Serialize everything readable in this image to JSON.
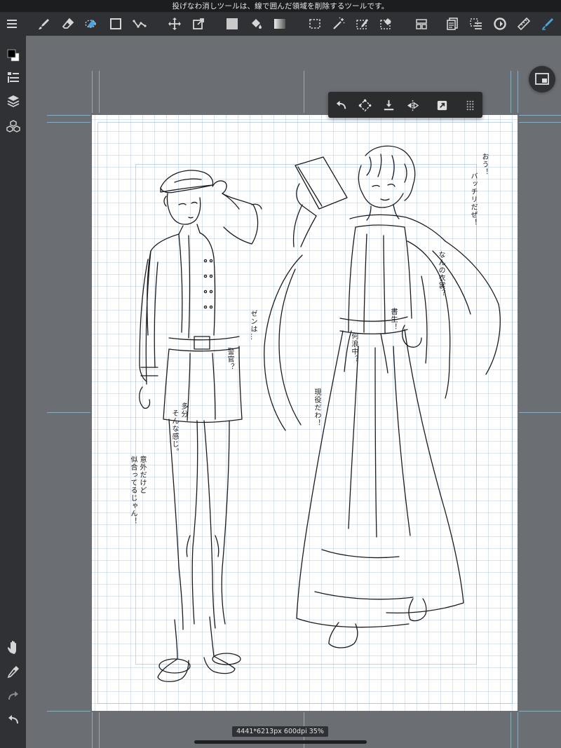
{
  "status_bar": {
    "hint": "投げなわ消しツールは、線で囲んだ領域を削除するツールです。"
  },
  "toolbar": {
    "tools": [
      "menu-icon",
      "brush-icon",
      "eraser-icon",
      "lasso-eraser-icon",
      "rectangle-icon",
      "polyline-icon",
      "move-icon",
      "transform-icon",
      "fill-color-icon",
      "bucket-icon",
      "gradient-icon",
      "select-rect-icon",
      "magic-wand-icon",
      "select-pen-icon",
      "select-eraser-icon",
      "panel-icon",
      "pages-icon",
      "select-layer-icon",
      "rotate-icon",
      "ruler-icon",
      "pen-active-icon"
    ]
  },
  "float_bar": {
    "tools": [
      "undo-icon",
      "free-transform-icon",
      "download-icon",
      "flip-icon",
      "copy-icon",
      "more-icon"
    ]
  },
  "sidebar": {
    "tools": [
      "color-swatch-icon",
      "layer-list-icon",
      "layers-icon",
      "materials-icon",
      "hand-icon",
      "eyedropper-icon",
      "redo-icon",
      "undo-icon"
    ]
  },
  "colors": {
    "foreground": "#000000",
    "background": "#ffffff",
    "accent": "#4aa3df"
  },
  "canvas": {
    "info": "4441*6213px 600dpi 35%"
  },
  "dialogue": {
    "t1a": "おう！",
    "t1b": "バッチリだぜ！",
    "t2": "なんの衣裳？",
    "t3": "書生！",
    "t4": "何浪中？",
    "t5": "現役だわ！",
    "t6": "ゼンは…",
    "t7": "警官？",
    "t8a": "そんな感じ。",
    "t8b": "多分",
    "t9a": "似合ってるじゃん！",
    "t9b": "意外だけど"
  }
}
